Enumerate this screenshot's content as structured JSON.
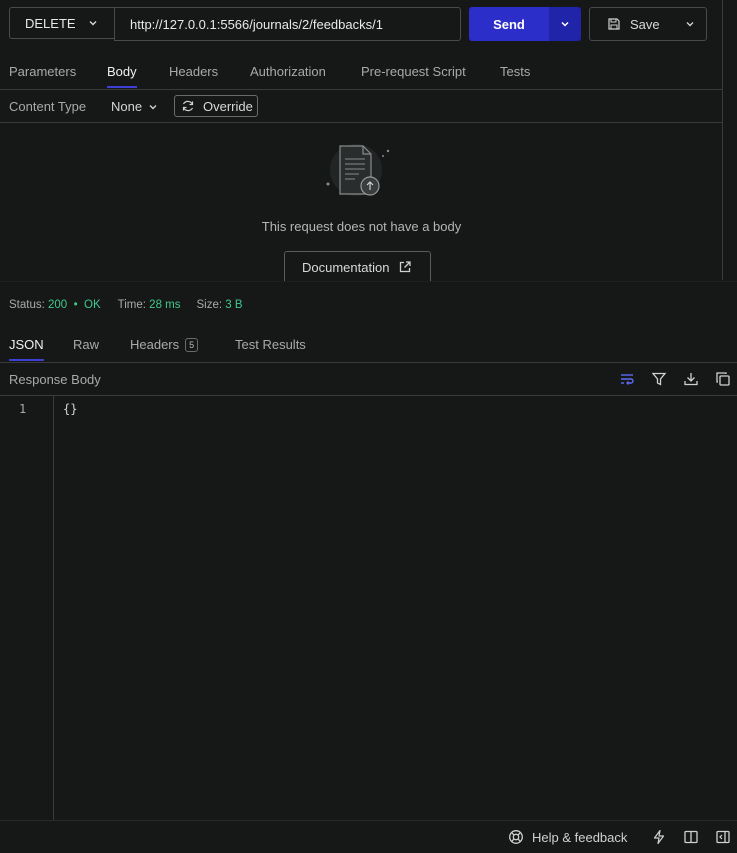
{
  "request": {
    "method": "DELETE",
    "url": "http://127.0.0.1:5566/journals/2/feedbacks/1",
    "send_label": "Send",
    "save_label": "Save"
  },
  "request_tabs": [
    "Parameters",
    "Body",
    "Headers",
    "Authorization",
    "Pre-request Script",
    "Tests"
  ],
  "active_request_tab": "Body",
  "body": {
    "content_type_label": "Content Type",
    "content_type_value": "None",
    "override_label": "Override",
    "empty_message": "This request does not have a body",
    "documentation_label": "Documentation"
  },
  "status": {
    "status_label": "Status:",
    "code": "200",
    "separator": "•",
    "text": "OK",
    "time_label": "Time:",
    "time_value": "28 ms",
    "size_label": "Size:",
    "size_value": "3 B"
  },
  "response_tabs": {
    "json": "JSON",
    "raw": "Raw",
    "headers": "Headers",
    "headers_count": "5",
    "test_results": "Test Results"
  },
  "response_body": {
    "label": "Response Body",
    "line_number": "1",
    "code": "{}"
  },
  "footer": {
    "help_label": "Help & feedback"
  },
  "colors": {
    "background": "#161818",
    "accent": "#3d3fd6",
    "send_button": "#2b2ec9",
    "status_ok": "#3fc88a",
    "wrap_icon_active": "#5a6cf5"
  },
  "icons": [
    "chevron-down-icon",
    "save-icon",
    "refresh-icon",
    "document-upload-icon",
    "external-link-icon",
    "wrap-lines-icon",
    "filter-icon",
    "download-icon",
    "copy-icon",
    "lifebuoy-icon",
    "bolt-icon",
    "columns-icon",
    "panel-collapse-icon"
  ]
}
